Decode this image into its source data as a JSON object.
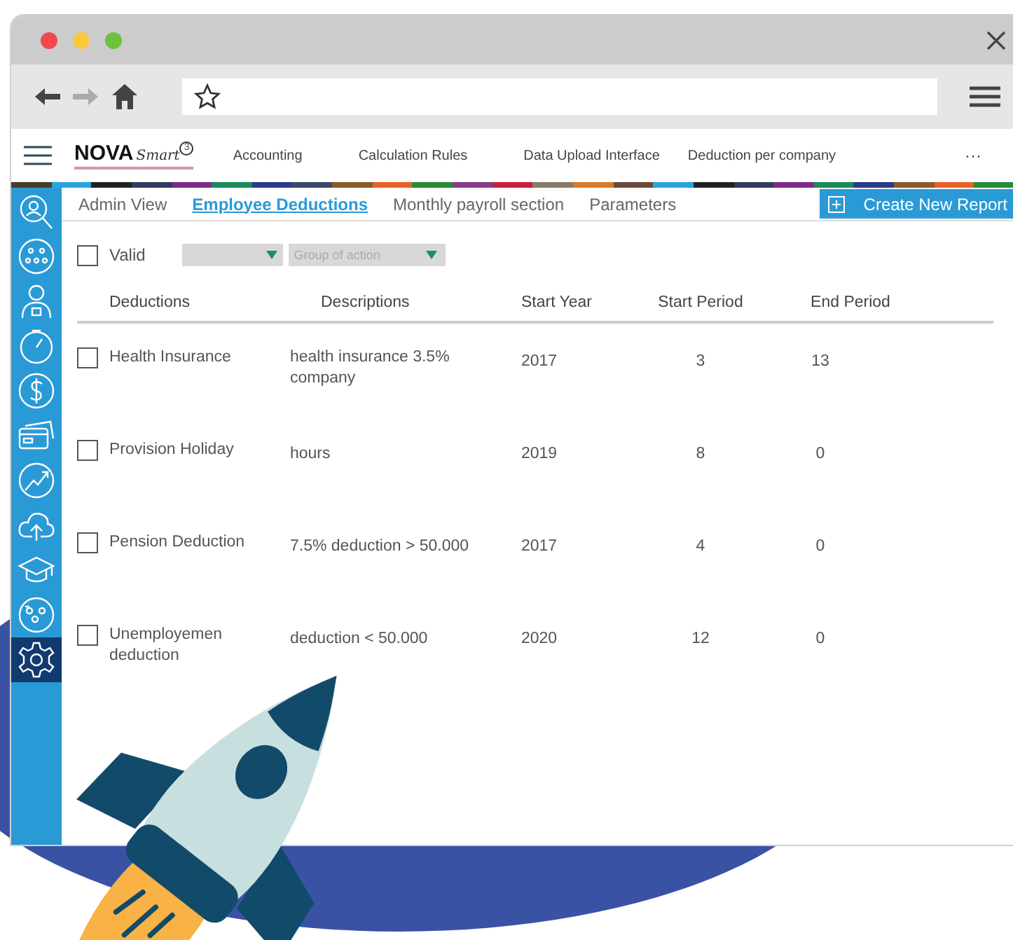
{
  "app": {
    "logo": {
      "name": "NOVA",
      "suffix": "Smart",
      "badge": "3"
    },
    "menu": [
      "Accounting",
      "Calculation Rules",
      "Data Upload Interface",
      "Deduction per company"
    ],
    "more": "···",
    "sidebar": [
      {
        "selected": false
      },
      {
        "selected": false
      },
      {
        "selected": false
      },
      {
        "selected": false
      },
      {
        "selected": false
      },
      {
        "selected": false
      },
      {
        "selected": false
      },
      {
        "selected": false
      },
      {
        "selected": false
      },
      {
        "selected": false
      },
      {
        "selected": true
      }
    ],
    "tabs": [
      {
        "label": "Admin View",
        "selected": false
      },
      {
        "label": "Employee Deductions",
        "selected": true
      },
      {
        "label": "Monthly payroll section",
        "selected": false
      },
      {
        "label": "Parameters",
        "selected": false
      }
    ],
    "create_button": "Create New Report",
    "filters": {
      "valid": {
        "label": "Valid",
        "checked": false
      },
      "group": {
        "placeholder": "Group of action"
      }
    },
    "table": {
      "columns": [
        "Deductions",
        "Descriptions",
        "Start Year",
        "Start Period",
        "End Period"
      ],
      "rows": [
        {
          "checked": false,
          "cells": [
            "Health Insurance",
            "health insurance 3.5% company",
            "2017",
            "3",
            "13"
          ]
        },
        {
          "checked": false,
          "cells": [
            "Provision Holiday",
            "hours",
            "2019",
            "8",
            "0"
          ]
        },
        {
          "checked": false,
          "cells": [
            "Pension Deduction",
            "7.5% deduction > 50.000",
            "2017",
            "4",
            "0"
          ]
        },
        {
          "checked": false,
          "cells": [
            "Unemployemen deduction",
            "deduction < 50.000",
            "2020",
            "12",
            "0"
          ]
        }
      ]
    }
  }
}
